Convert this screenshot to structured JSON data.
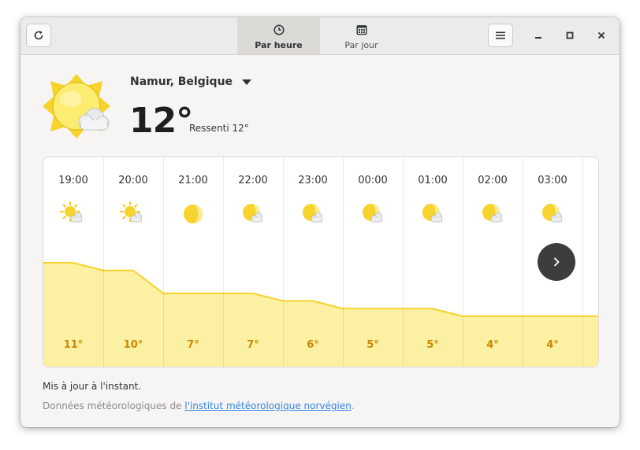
{
  "header": {
    "refresh_icon": "refresh-icon",
    "tabs": [
      {
        "label": "Par heure",
        "icon": "clock-icon",
        "active": true
      },
      {
        "label": "Par jour",
        "icon": "calendar-icon",
        "active": false
      }
    ],
    "menu_icon": "hamburger-menu-icon",
    "window_controls": [
      "minimize-icon",
      "maximize-icon",
      "close-icon"
    ]
  },
  "current": {
    "location": "Namur, Belgique",
    "temperature": "12°",
    "feels_like": "Ressenti 12°",
    "icon": "sun-with-cloud-icon"
  },
  "hourly": {
    "hours": [
      {
        "time": "19:00",
        "icon": "sun-cloud-icon",
        "temp": "11°"
      },
      {
        "time": "20:00",
        "icon": "sun-cloud-icon",
        "temp": "10°"
      },
      {
        "time": "21:00",
        "icon": "moon-icon",
        "temp": "7°"
      },
      {
        "time": "22:00",
        "icon": "moon-cloud-icon",
        "temp": "7°"
      },
      {
        "time": "23:00",
        "icon": "moon-cloud-icon",
        "temp": "6°"
      },
      {
        "time": "00:00",
        "icon": "moon-cloud-icon",
        "temp": "5°"
      },
      {
        "time": "01:00",
        "icon": "moon-cloud-icon",
        "temp": "5°"
      },
      {
        "time": "02:00",
        "icon": "moon-cloud-icon",
        "temp": "4°"
      },
      {
        "time": "03:00",
        "icon": "moon-cloud-icon",
        "temp": "4°"
      }
    ],
    "temp_values": [
      11,
      10,
      7,
      7,
      6,
      5,
      5,
      4,
      4
    ],
    "next_icon": "chevron-right-icon"
  },
  "footer": {
    "updated": "Mis à jour à l'instant.",
    "credits_prefix": "Données météorologiques de ",
    "credits_link": "l'institut météorologique norvégien",
    "credits_suffix": "."
  },
  "colors": {
    "accent_yellow": "#f6d32d",
    "area_fill": "#fcf0a3",
    "temp_label": "#c88800"
  }
}
